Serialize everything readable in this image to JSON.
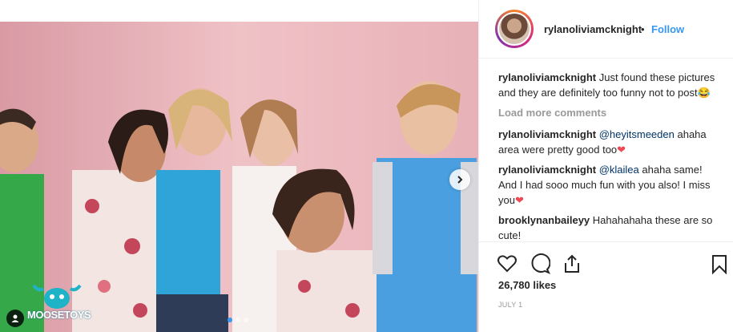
{
  "post": {
    "username": "rylanoliviamcknight",
    "separator": "•",
    "follow_label": "Follow",
    "likes": "26,780 likes",
    "date": "JULY 1",
    "load_more": "Load more comments"
  },
  "comments": [
    {
      "user": "rylanoliviamcknight",
      "mention": "",
      "text": "Just found these pictures and they are definitely too funny not to post",
      "emoji": "😂"
    },
    {
      "user": "rylanoliviamcknight",
      "mention": "@heyitsmeeden",
      "text": "ahaha area were pretty good too",
      "emoji": "❤"
    },
    {
      "user": "rylanoliviamcknight",
      "mention": "@klailea",
      "text": "ahaha same! And I had sooo much fun with you also! I miss you",
      "emoji": "❤"
    },
    {
      "user": "brooklynanbaileyy",
      "mention": "",
      "text": "Hahahahaha these are so cute!",
      "emoji": ""
    }
  ],
  "watermark": {
    "text": "MOOSETOYS"
  },
  "carousel": {
    "active_index": 0,
    "count": 3
  },
  "colors": {
    "accent": "#3897f0",
    "backdrop": "#e9b3ba",
    "heart": "#ed4956"
  },
  "icons": [
    "heart-icon",
    "comment-icon",
    "share-icon",
    "bookmark-icon",
    "chevron-right-icon",
    "user-tag-icon"
  ]
}
